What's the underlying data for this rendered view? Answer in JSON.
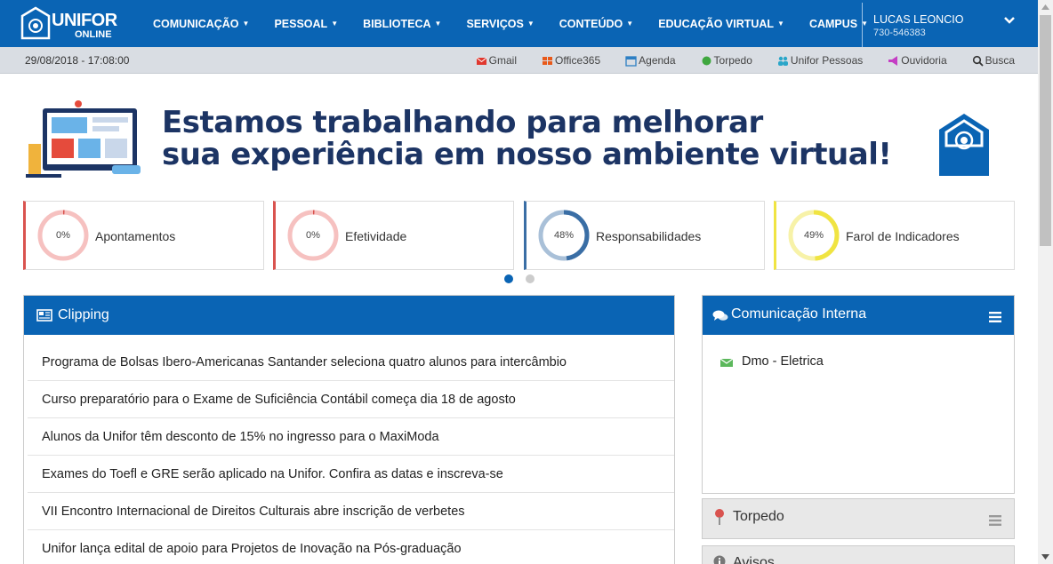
{
  "brand": {
    "title": "UNIFOR",
    "subtitle": "ONLINE"
  },
  "nav": [
    {
      "label": "COMUNICAÇÃO"
    },
    {
      "label": "PESSOAL"
    },
    {
      "label": "BIBLIOTECA"
    },
    {
      "label": "SERVIÇOS"
    },
    {
      "label": "CONTEÚDO"
    },
    {
      "label": "EDUCAÇÃO VIRTUAL"
    },
    {
      "label": "CAMPUS"
    }
  ],
  "user": {
    "name": "LUCAS LEONCIO",
    "id": "730-546383"
  },
  "subbar": {
    "datetime": "29/08/2018 - 17:08:00",
    "links": [
      {
        "label": "Gmail",
        "icon": "envelope-icon",
        "color": "#e0382f"
      },
      {
        "label": "Office365",
        "icon": "office-icon",
        "color": "#e8591a"
      },
      {
        "label": "Agenda",
        "icon": "calendar-icon",
        "color": "#2d7fc4"
      },
      {
        "label": "Torpedo",
        "icon": "dot-icon",
        "color": "#3fa73f"
      },
      {
        "label": "Unifor Pessoas",
        "icon": "users-icon",
        "color": "#2aa6c9"
      },
      {
        "label": "Ouvidoria",
        "icon": "megaphone-icon",
        "color": "#c43ec4"
      },
      {
        "label": "Busca",
        "icon": "search-icon",
        "color": "#333333"
      }
    ]
  },
  "banner": {
    "line1": "Estamos trabalhando para melhorar",
    "line2": "sua experiência em nosso ambiente virtual!"
  },
  "indicators": [
    {
      "label": "Apontamentos",
      "percent": 0,
      "percent_text": "0%",
      "color": "#d9534f",
      "track": "#f6c1c0"
    },
    {
      "label": "Efetividade",
      "percent": 0,
      "percent_text": "0%",
      "color": "#d9534f",
      "track": "#f6c1c0"
    },
    {
      "label": "Responsabilidades",
      "percent": 48,
      "percent_text": "48%",
      "color": "#3a6ea5",
      "track": "#a9c0d8"
    },
    {
      "label": "Farol de Indicadores",
      "percent": 49,
      "percent_text": "49%",
      "color": "#f0e442",
      "track": "#f7f2a8"
    }
  ],
  "carousel": {
    "active_page": 1,
    "pages": 2
  },
  "clipping": {
    "title": "Clipping",
    "items": [
      "Programa de Bolsas Ibero-Americanas Santander seleciona quatro alunos para intercâmbio",
      "Curso preparatório para o Exame de Suficiência Contábil começa dia 18 de agosto",
      "Alunos da Unifor têm desconto de 15% no ingresso para o MaxiModa",
      "Exames do Toefl e GRE serão aplicado na Unifor. Confira as datas e inscreva-se",
      "VII Encontro Internacional de Direitos Culturais abre inscrição de verbetes",
      "Unifor lança edital de apoio para Projetos de Inovação na Pós-graduação"
    ]
  },
  "comunicacao": {
    "title": "Comunicação Interna",
    "items": [
      "Dmo - Eletrica"
    ]
  },
  "torpedo": {
    "title": "Torpedo"
  },
  "avisos": {
    "title": "Avisos"
  }
}
